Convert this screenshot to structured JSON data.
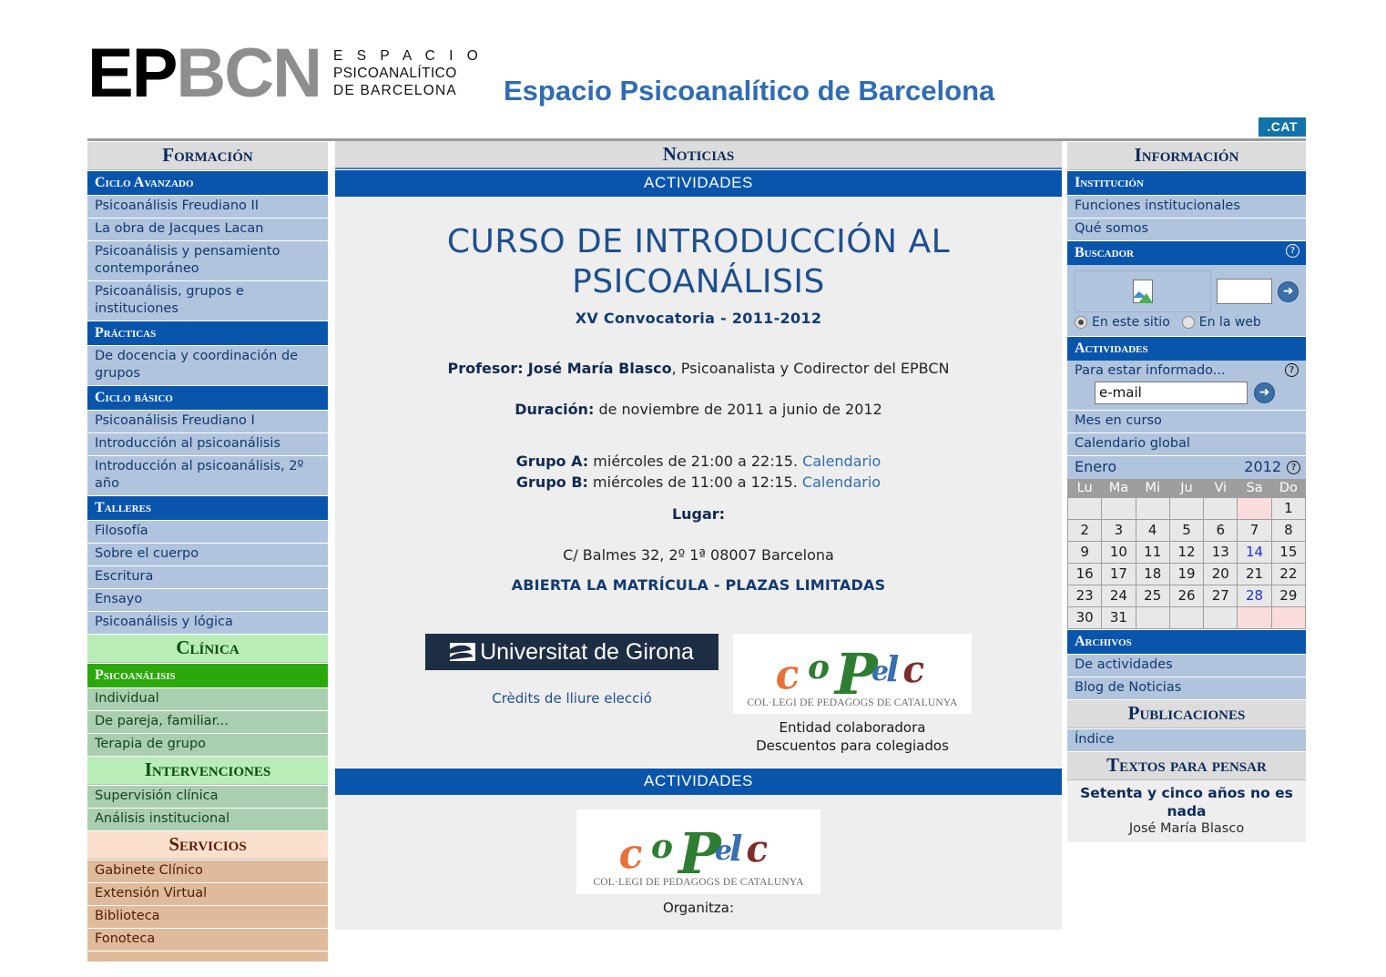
{
  "header": {
    "logo_ep": "EP",
    "logo_bcn": "BCN",
    "logo_sub_1": "E S P A C I O",
    "logo_sub_2": "PSICOANALÍTICO",
    "logo_sub_3": "DE BARCELONA",
    "site_title": "Espacio Psicoanalítico de Barcelona",
    "cat_badge": ".CAT"
  },
  "left": {
    "title": "Formación",
    "groups": [
      {
        "head": "Ciclo Avanzado",
        "style": "blue",
        "items": [
          "Psicoanálisis Freudiano II",
          "La obra de Jacques Lacan",
          "Psicoanálisis y pensamiento contemporáneo",
          "Psicoanálisis, grupos e instituciones"
        ]
      },
      {
        "head": "Prácticas",
        "style": "blue",
        "items": [
          "De docencia y coordinación de grupos"
        ]
      },
      {
        "head": "Ciclo básico",
        "style": "blue",
        "items": [
          "Psicoanálisis Freudiano I",
          "Introducción al psicoanálisis",
          "Introducción al psicoanálisis, 2º año"
        ]
      },
      {
        "head": "Talleres",
        "style": "blue",
        "items": [
          "Filosofía",
          "Sobre el cuerpo",
          "Escritura",
          "Ensayo",
          "Psicoanálisis y lógica"
        ]
      }
    ],
    "clinica_title": "Clínica",
    "clinica_head": "Psicoanálisis",
    "clinica_items": [
      "Individual",
      "De pareja, familiar...",
      "Terapia de grupo"
    ],
    "intervenciones_title": "Intervenciones",
    "intervenciones_items": [
      "Supervisión clínica",
      "Análisis institucional"
    ],
    "servicios_title": "Servicios",
    "servicios_items": [
      "Gabinete Clínico",
      "Extensión Virtual",
      "Biblioteca",
      "Fonoteca"
    ]
  },
  "main": {
    "panel_title": "Noticias",
    "bar_top": "ACTIVIDADES",
    "bar_bottom": "ACTIVIDADES",
    "course_title": "CURSO DE INTRODUCCIÓN AL PSICOANÁLISIS",
    "course_sub": "XV Convocatoria - 2011-2012",
    "profesor_label": "Profesor:",
    "profesor_name": "José María Blasco",
    "profesor_rest": ", Psicoanalista y Codirector del EPBCN",
    "duracion_label": "Duración:",
    "duracion_value": "de noviembre de 2011 a junio de 2012",
    "grupo_a_label": "Grupo A:",
    "grupo_a_value": "miércoles de 21:00 a 22:15.",
    "grupo_a_link": "Calendario",
    "grupo_b_label": "Grupo B:",
    "grupo_b_value": "miércoles de 11:00 a 12:15.",
    "grupo_b_link": "Calendario",
    "lugar_label": "Lugar:",
    "lugar_value": "C/ Balmes 32, 2º 1ª 08007 Barcelona",
    "matricula": "ABIERTA LA MATRÍCULA - PLAZAS LIMITADAS",
    "udg_name": "Universitat de Girona",
    "udg_caption": "Crèdits de lliure elecció",
    "copec_letters": [
      "c",
      "o",
      "P",
      "e",
      "l",
      "c"
    ],
    "copec_subtitle": "COL·LEGI DE PEDAGOGS DE CATALUNYA",
    "copec_caption_1": "Entidad colaboradora",
    "copec_caption_2": "Descuentos para colegiados",
    "organiza": "Organitza:"
  },
  "right": {
    "title": "Información",
    "institucion_head": "Institución",
    "institucion_items": [
      "Funciones institucionales",
      "Qué somos"
    ],
    "buscador_head": "Buscador",
    "search_scope_site": "En este sitio",
    "search_scope_web": "En la web",
    "actividades_head": "Actividades",
    "mail_label": "Para estar informado...",
    "mail_value": "e-mail",
    "actividades_items": [
      "Mes en curso",
      "Calendario global"
    ],
    "calendar": {
      "month": "Enero",
      "year": "2012",
      "daynames": [
        "Lu",
        "Ma",
        "Mi",
        "Ju",
        "Vi",
        "Sa",
        "Do"
      ],
      "weeks": [
        [
          {
            "n": "",
            "c": "empty"
          },
          {
            "n": "",
            "c": "empty"
          },
          {
            "n": "",
            "c": "empty"
          },
          {
            "n": "",
            "c": "empty"
          },
          {
            "n": "",
            "c": "empty"
          },
          {
            "n": "",
            "c": "empty we"
          },
          {
            "n": "1",
            "c": "hol"
          }
        ],
        [
          {
            "n": "2",
            "c": ""
          },
          {
            "n": "3",
            "c": ""
          },
          {
            "n": "4",
            "c": ""
          },
          {
            "n": "5",
            "c": ""
          },
          {
            "n": "6",
            "c": "hol"
          },
          {
            "n": "7",
            "c": "today"
          },
          {
            "n": "8",
            "c": "we"
          }
        ],
        [
          {
            "n": "9",
            "c": "link"
          },
          {
            "n": "10",
            "c": ""
          },
          {
            "n": "11",
            "c": "link"
          },
          {
            "n": "12",
            "c": "link"
          },
          {
            "n": "13",
            "c": "link"
          },
          {
            "n": "14",
            "c": "we link"
          },
          {
            "n": "15",
            "c": "we"
          }
        ],
        [
          {
            "n": "16",
            "c": "link"
          },
          {
            "n": "17",
            "c": ""
          },
          {
            "n": "18",
            "c": "link"
          },
          {
            "n": "19",
            "c": "link"
          },
          {
            "n": "20",
            "c": ""
          },
          {
            "n": "21",
            "c": "we"
          },
          {
            "n": "22",
            "c": "we"
          }
        ],
        [
          {
            "n": "23",
            "c": "link"
          },
          {
            "n": "24",
            "c": ""
          },
          {
            "n": "25",
            "c": "link"
          },
          {
            "n": "26",
            "c": "link"
          },
          {
            "n": "27",
            "c": ""
          },
          {
            "n": "28",
            "c": "we link"
          },
          {
            "n": "29",
            "c": "we"
          }
        ],
        [
          {
            "n": "30",
            "c": "link"
          },
          {
            "n": "31",
            "c": ""
          },
          {
            "n": "",
            "c": "empty"
          },
          {
            "n": "",
            "c": "empty"
          },
          {
            "n": "",
            "c": "empty"
          },
          {
            "n": "",
            "c": "empty we"
          },
          {
            "n": "",
            "c": "empty we"
          }
        ]
      ]
    },
    "archivos_head": "Archivos",
    "archivos_items": [
      "De actividades",
      "Blog de Noticias"
    ],
    "publicaciones_title": "Publicaciones",
    "publicaciones_items": [
      "Índice"
    ],
    "textos_title": "Textos para pensar",
    "textos_headline": "Setenta y cinco años no es nada",
    "textos_author": "José María Blasco"
  }
}
